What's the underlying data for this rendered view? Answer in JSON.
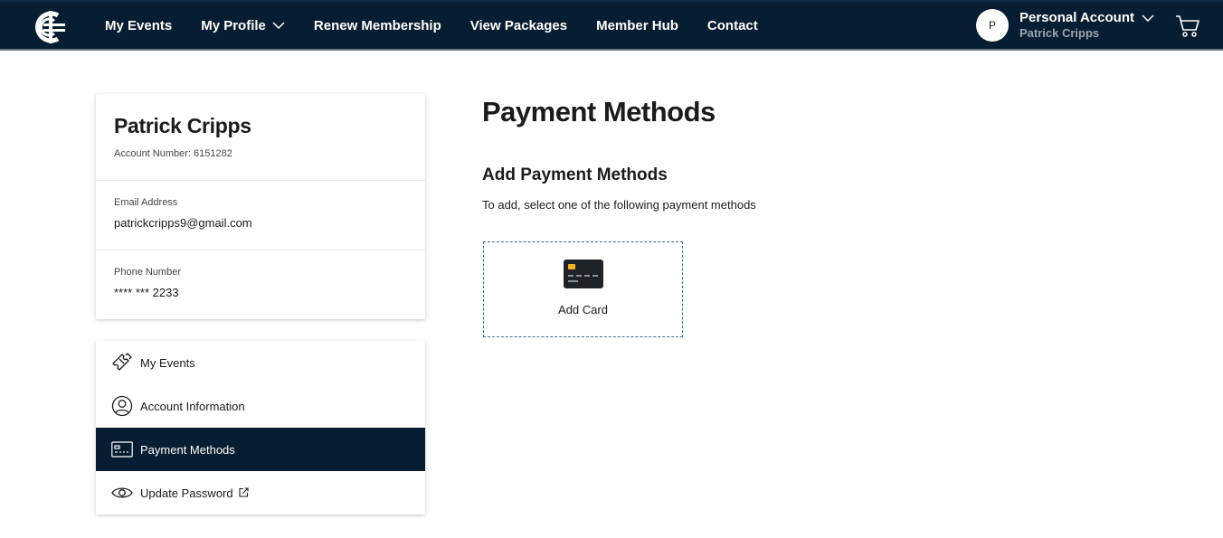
{
  "brand": {
    "logo_icon": "carlton-cfc-logo"
  },
  "nav": {
    "items": [
      {
        "label": "My Events"
      },
      {
        "label": "My Profile",
        "has_dropdown": true
      },
      {
        "label": "Renew Membership"
      },
      {
        "label": "View Packages"
      },
      {
        "label": "Member Hub"
      },
      {
        "label": "Contact"
      }
    ]
  },
  "account": {
    "avatar_initial": "P",
    "title": "Personal Account",
    "name": "Patrick Cripps",
    "cart_icon": "cart-icon"
  },
  "profile": {
    "name": "Patrick Cripps",
    "account_number": "Account Number: 6151282",
    "email_label": "Email Address",
    "email": "patrickcripps9@gmail.com",
    "phone_label": "Phone Number",
    "phone": "**** *** 2233"
  },
  "sidebar": {
    "items": [
      {
        "label": "My Events",
        "icon": "tickets-icon",
        "active": false
      },
      {
        "label": "Account Information",
        "icon": "user-circle-icon",
        "active": false
      },
      {
        "label": "Payment Methods",
        "icon": "payment-card-icon",
        "active": true
      },
      {
        "label": "Update Password",
        "icon": "eye-icon",
        "active": false,
        "external": true
      }
    ]
  },
  "main": {
    "title": "Payment Methods",
    "section_title": "Add Payment Methods",
    "section_desc": "To add, select one of the following payment methods",
    "add_card_label": "Add Card",
    "add_card_icon": "credit-card-icon"
  },
  "colors": {
    "navbar": "#071d31",
    "active_item": "#071d31",
    "dashed_border": "#3a6f96",
    "card_chip": "#f2b41c"
  }
}
